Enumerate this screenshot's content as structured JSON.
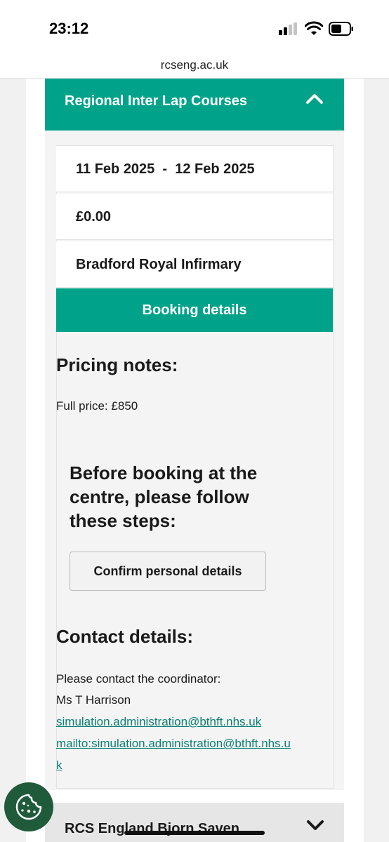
{
  "status_bar": {
    "time": "23:12"
  },
  "browser": {
    "url": "rcseng.ac.uk"
  },
  "accordion": {
    "title": "Regional Inter Lap Courses",
    "expanded": true,
    "dates": "11 Feb 2025  -  12 Feb 2025",
    "price": "£0.00",
    "venue": "Bradford Royal Infirmary",
    "booking_button": "Booking details"
  },
  "pricing": {
    "heading": "Pricing notes:",
    "full_price": "Full price: £850"
  },
  "steps": {
    "heading": "Before booking at the centre, please follow these steps:",
    "confirm_button": "Confirm personal details"
  },
  "contact": {
    "heading": "Contact details:",
    "intro": "Please contact the coordinator:",
    "name": "Ms T Harrison",
    "email": "simulation.administration@bthft.nhs.uk",
    "mailto_line1": "mailto:simulation.administration@bthft.nhs.u",
    "mailto_line2": "k"
  },
  "next_accordion": {
    "title": "RCS England Bjorn Saven"
  },
  "colors": {
    "accent": "#00a38a",
    "link": "#0b7f74",
    "cookie_button": "#1f5a3a"
  },
  "icons": [
    "chevron-up-icon",
    "chevron-down-icon",
    "cookie-icon",
    "signal-icon",
    "wifi-icon",
    "battery-icon"
  ]
}
